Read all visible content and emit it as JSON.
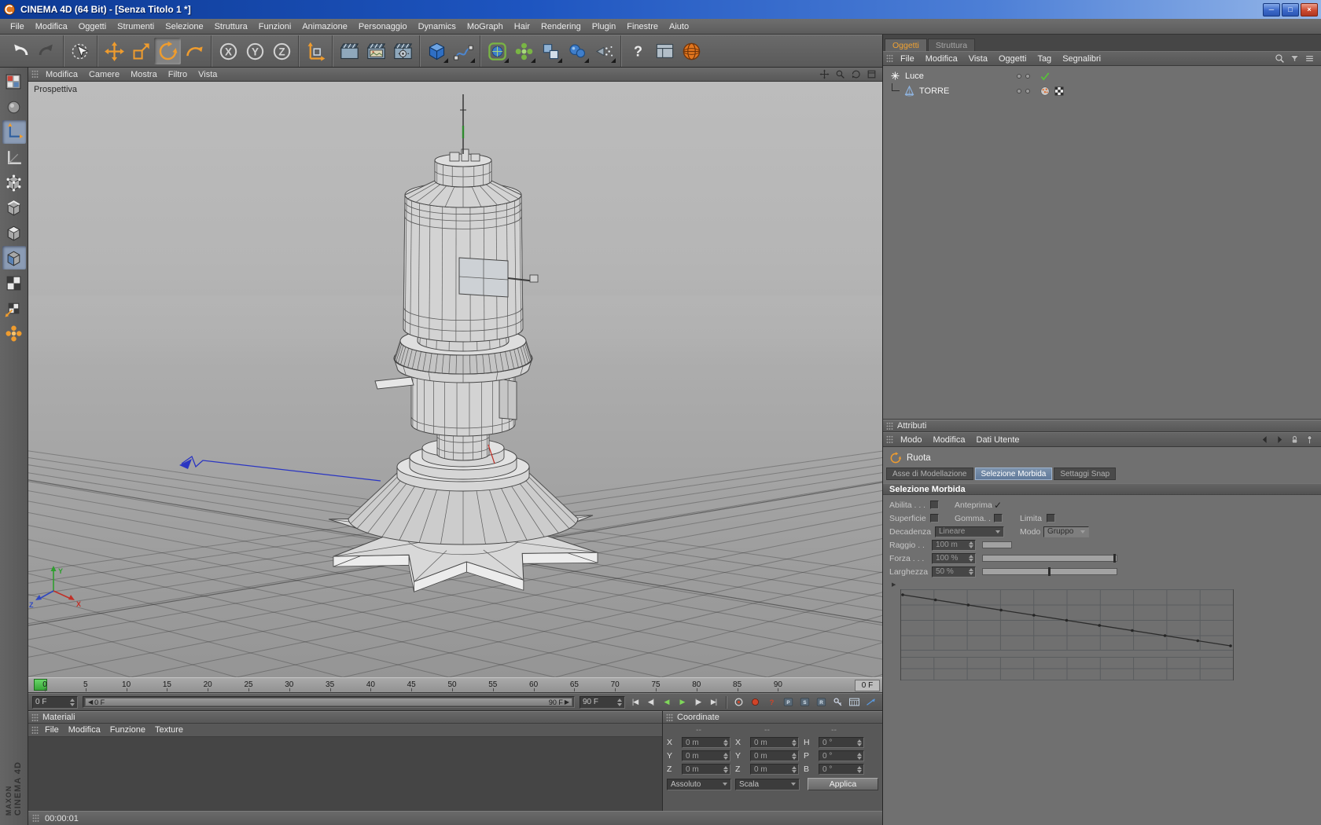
{
  "titlebar": {
    "title": "CINEMA 4D (64 Bit) - [Senza Titolo 1 *]"
  },
  "menubar": {
    "items": [
      "File",
      "Modifica",
      "Oggetti",
      "Strumenti",
      "Selezione",
      "Struttura",
      "Funzioni",
      "Animazione",
      "Personaggio",
      "Dynamics",
      "MoGraph",
      "Hair",
      "Rendering",
      "Plugin",
      "Finestre",
      "Aiuto"
    ]
  },
  "toolbar": {
    "pressed": "rotate-tool-icon",
    "groups": [
      [
        "undo-icon",
        "redo-icon"
      ],
      [
        "live-selection-icon"
      ],
      [
        "move-tool-icon",
        "scale-tool-icon",
        "rotate-tool-icon",
        "recent-tool-icon"
      ],
      [
        "axis-x-lock-icon",
        "axis-y-lock-icon",
        "axis-z-lock-icon"
      ],
      [
        "coordinate-system-icon"
      ],
      [
        "render-view-icon",
        "render-picture-viewer-icon",
        "render-settings-icon"
      ],
      [
        "add-cube-icon",
        "draw-spline-icon"
      ],
      [
        "add-subdivision-icon",
        "add-array-icon",
        "add-boole-icon",
        "add-metaball-icon",
        "add-particles-icon"
      ],
      [
        "help-icon",
        "content-browser-icon",
        "online-updater-icon"
      ]
    ]
  },
  "left_palette": {
    "icons": [
      "convert-icon",
      "model-mode-icon",
      "object-axis-mode-icon",
      "workplane-icon",
      "points-mode-icon",
      "edges-mode-icon",
      "polygons-mode-icon",
      "animation-mode-icon",
      "texture-mode-icon",
      "texture-axis-mode-icon",
      "selection-filter-icon"
    ],
    "pressed": [
      "object-axis-mode-icon",
      "animation-mode-icon"
    ],
    "brand": {
      "line1": "MAXON",
      "line2": "CINEMA 4D"
    }
  },
  "viewport": {
    "label": "Prospettiva",
    "menu": [
      "Modifica",
      "Camere",
      "Mostra",
      "Filtro",
      "Vista"
    ],
    "nav_icons": [
      "pan-view-icon",
      "zoom-view-icon",
      "orbit-view-icon",
      "toggle-view-icon"
    ]
  },
  "timeline": {
    "ticks": [
      "0",
      "5",
      "10",
      "15",
      "20",
      "25",
      "30",
      "35",
      "40",
      "45",
      "50",
      "55",
      "60",
      "65",
      "70",
      "75",
      "80",
      "85",
      "90"
    ],
    "ruler_end_label": "0 F",
    "current_frame": "0 F",
    "range_start": "0 F",
    "range_end": "90 F",
    "last_frame": "90 F",
    "transport": [
      "goto-start-icon",
      "prev-frame-icon",
      "play-backward-icon",
      "play-forward-icon",
      "next-frame-icon",
      "goto-end-icon"
    ],
    "extra_icons": [
      "record-keyframe-icon",
      "autokey-icon",
      "options-help-icon",
      "key-position-icon",
      "key-scale-icon",
      "key-rotation-icon",
      "key-parameter-icon",
      "timeline-panel-icon",
      "ramp-icon"
    ]
  },
  "materials_panel": {
    "title": "Materiali",
    "menu": [
      "File",
      "Modifica",
      "Funzione",
      "Texture"
    ]
  },
  "coordinates_panel": {
    "title": "Coordinate",
    "groups": [
      {
        "header": "--",
        "rows": [
          {
            "label": "X",
            "value": "0 m"
          },
          {
            "label": "Y",
            "value": "0 m"
          },
          {
            "label": "Z",
            "value": "0 m"
          }
        ]
      },
      {
        "header": "--",
        "rows": [
          {
            "label": "X",
            "value": "0 m"
          },
          {
            "label": "Y",
            "value": "0 m"
          },
          {
            "label": "Z",
            "value": "0 m"
          }
        ]
      },
      {
        "header": "--",
        "rows": [
          {
            "label": "H",
            "value": "0 °"
          },
          {
            "label": "P",
            "value": "0 °"
          },
          {
            "label": "B",
            "value": "0 °"
          }
        ]
      }
    ],
    "mode_dropdown": "Assoluto",
    "scale_dropdown": "Scala",
    "apply_button": "Applica"
  },
  "object_manager": {
    "tabs": [
      {
        "label": "Oggetti",
        "active": true
      },
      {
        "label": "Struttura",
        "active": false
      }
    ],
    "menu": [
      "File",
      "Modifica",
      "Vista",
      "Oggetti",
      "Tag",
      "Segnalibri"
    ],
    "right_icons": [
      "search-icon",
      "filter-icon",
      "panel-menu-icon"
    ],
    "objects": [
      {
        "name": "Luce",
        "icon": "light-object-icon",
        "tags": [
          "enabled-check-icon"
        ]
      },
      {
        "name": "TORRE",
        "icon": "cone-object-icon",
        "tags": [
          "phong-tag-icon",
          "texture-tag-icon"
        ]
      }
    ]
  },
  "attributes_panel": {
    "title": "Attributi",
    "menu": [
      "Modo",
      "Modifica",
      "Dati Utente"
    ],
    "right_icons": [
      "history-back-icon",
      "history-forward-icon",
      "lock-icon",
      "pin-icon"
    ],
    "tool_name": "Ruota",
    "tabs": [
      {
        "label": "Asse di Modellazione",
        "active": false
      },
      {
        "label": "Selezione Morbida",
        "active": true
      },
      {
        "label": "Settaggi Snap",
        "active": false
      }
    ],
    "section_title": "Selezione Morbida",
    "properties": {
      "abilita_label": "Abilita . . .",
      "abilita_checked": false,
      "anteprima_label": "Anteprima",
      "anteprima_checked": true,
      "superficie_label": "Superficie",
      "superficie_checked": false,
      "gomma_label": "Gomma. . .",
      "gomma_checked": false,
      "limita_label": "Limita",
      "limita_checked": false,
      "decadenza_label": "Decadenza",
      "decadenza_value": "Lineare",
      "modo_label": "Modo",
      "modo_value": "Gruppo",
      "raggio_label": "Raggio . .",
      "raggio_value": "100 m",
      "forza_label": "Forza . . .",
      "forza_value": "100 %",
      "forza_percent": 100,
      "larghezza_label": "Larghezza",
      "larghezza_value": "50 %",
      "larghezza_percent": 50
    }
  },
  "statusbar": {
    "time": "00:00:01"
  }
}
